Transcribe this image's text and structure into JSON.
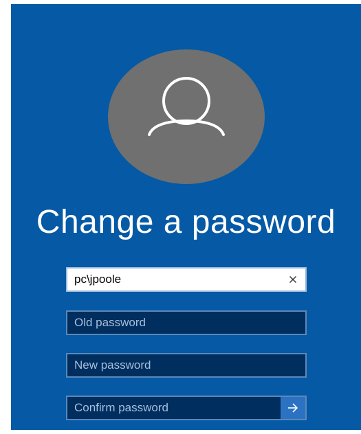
{
  "screen": {
    "background_color": "#0559a5",
    "avatar_color": "#707070"
  },
  "page": {
    "title": "Change a password"
  },
  "form": {
    "username": {
      "value": "pc\\jpoole",
      "clear_icon": "close-icon"
    },
    "old_password": {
      "placeholder": "Old password",
      "value": ""
    },
    "new_password": {
      "placeholder": "New password",
      "value": ""
    },
    "confirm_password": {
      "placeholder": "Confirm password",
      "value": ""
    },
    "submit_icon": "arrow-right-icon"
  }
}
